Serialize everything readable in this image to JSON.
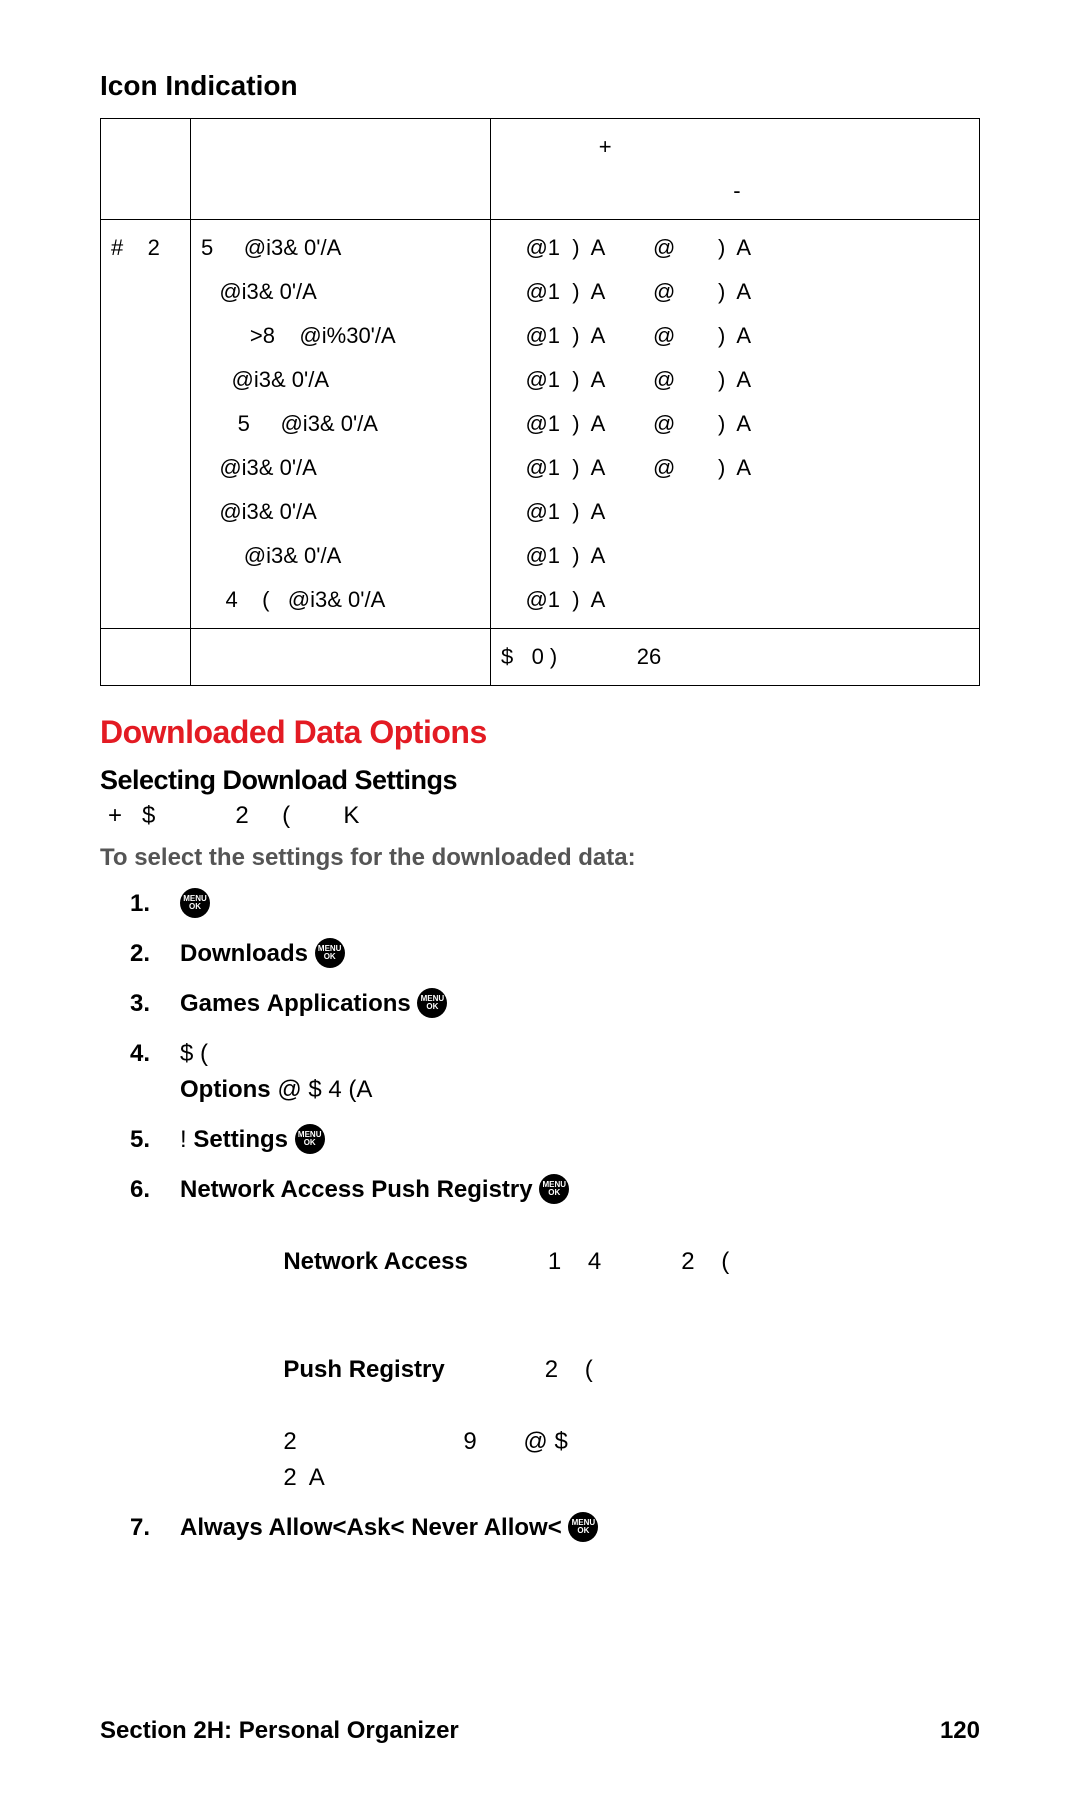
{
  "headings": {
    "icon_indication": "Icon Indication",
    "downloaded_data_options": "Downloaded Data Options",
    "selecting_download_settings": "Selecting Download Settings"
  },
  "table": {
    "header": {
      "c1": "",
      "c2": "",
      "c3": "                +\n                                      -"
    },
    "body": {
      "c1": "#    2",
      "c2": "5     @i3& 0'/A\n   @i3& 0'/A\n        >8    @i%30'/A\n     @i3& 0'/A\n      5     @i3& 0'/A\n   @i3& 0'/A\n   @i3& 0'/A\n       @i3& 0'/A\n    4    (   @i3& 0'/A",
      "c3": "    @1  )  A        @       )  A\n    @1  )  A        @       )  A\n    @1  )  A        @       )  A\n    @1  )  A        @       )  A\n    @1  )  A        @       )  A\n    @1  )  A        @       )  A\n    @1  )  A\n    @1  )  A\n    @1  )  A"
    },
    "foot": {
      "c1": "",
      "c2": "",
      "c3": "$   0 )             26"
    }
  },
  "settings_tag_line": "+   $            2     (        K",
  "lead": "To select the settings for the downloaded data:",
  "menu_ok_label": "MENU\nOK",
  "steps": {
    "s1_num": "1.",
    "s2_num": "2.",
    "s2_pre": "",
    "s2_bold": "Downloads",
    "s2_post": "       ",
    "s3_num": "3.",
    "s3_pre": "",
    "s3_bold1": "Games",
    "s3_mid": "    ",
    "s3_bold2": "Applications",
    "s3_post": "         ",
    "s4_num": "4.",
    "s4_line1": "            $       (",
    "s4_bold": "Options",
    "s4_line2": " @       $ 4 (A",
    "s5_num": "5.",
    "s5_pre": "!         ",
    "s5_bold": "Settings",
    "s5_post": "           ",
    "s6_num": "6.",
    "s6_bold1": "Network Access",
    "s6_mid1": "    ",
    "s6_bold2": "Push Registry",
    "s6_post1": "           ",
    "s6_sub1_bold": "Network Access",
    "s6_sub1_rest": "            1    4            2    (",
    "s6_sub2_bold": "Push Registry",
    "s6_sub2_rest": "               2    (",
    "s6_sub3": "        2                         9       @ $",
    "s6_sub4": "        2  A",
    "s7_num": "7.",
    "s7_bold": "Always Allow<Ask<    Never Allow<",
    "s7_post": "              "
  },
  "footer": {
    "section": "Section 2H: Personal Organizer",
    "page": "120"
  }
}
